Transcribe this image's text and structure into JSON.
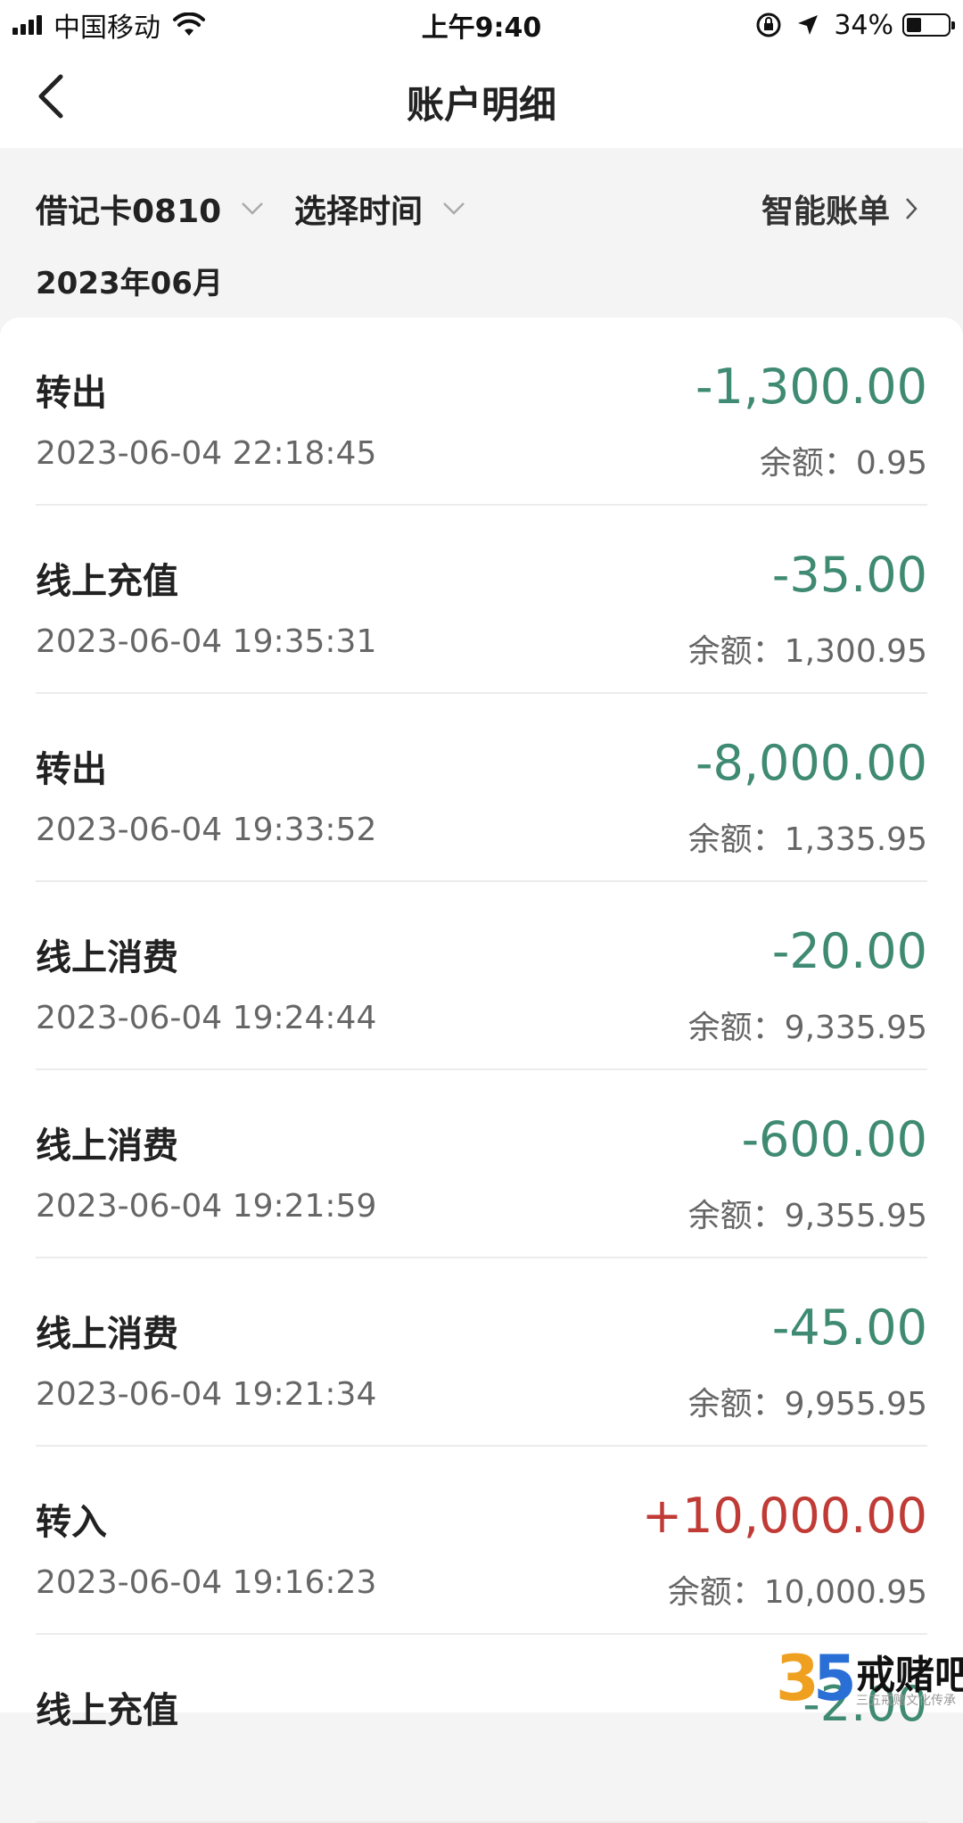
{
  "status_bar": {
    "carrier": "中国移动",
    "time": "上午9:40",
    "battery": "34%"
  },
  "nav": {
    "title": "账户明细",
    "back_icon": "chevron-left-icon"
  },
  "filters": {
    "card": "借记卡0810",
    "time": "选择时间",
    "smart_bill": "智能账单",
    "month": "2023年06月"
  },
  "transactions": [
    {
      "type": "转出",
      "time": "2023-06-04 22:18:45",
      "amount": "-1,300.00",
      "balance": "余额：0.95",
      "direction": "out"
    },
    {
      "type": "线上充值",
      "time": "2023-06-04 19:35:31",
      "amount": "-35.00",
      "balance": "余额：1,300.95",
      "direction": "out"
    },
    {
      "type": "转出",
      "time": "2023-06-04 19:33:52",
      "amount": "-8,000.00",
      "balance": "余额：1,335.95",
      "direction": "out"
    },
    {
      "type": "线上消费",
      "time": "2023-06-04 19:24:44",
      "amount": "-20.00",
      "balance": "余额：9,335.95",
      "direction": "out"
    },
    {
      "type": "线上消费",
      "time": "2023-06-04 19:21:59",
      "amount": "-600.00",
      "balance": "余额：9,355.95",
      "direction": "out"
    },
    {
      "type": "线上消费",
      "time": "2023-06-04 19:21:34",
      "amount": "-45.00",
      "balance": "余额：9,955.95",
      "direction": "out"
    },
    {
      "type": "转入",
      "time": "2023-06-04 19:16:23",
      "amount": "+10,000.00",
      "balance": "余额：10,000.95",
      "direction": "in"
    },
    {
      "type": "线上充值",
      "time": "",
      "amount": "-2.00",
      "balance": "",
      "direction": "out"
    }
  ],
  "colors": {
    "outgoing": "#3f8a72",
    "incoming": "#c03b35"
  },
  "watermark": {
    "logo": "35",
    "text": "戒赌吧",
    "sub": "三五戒赌文化传承"
  }
}
